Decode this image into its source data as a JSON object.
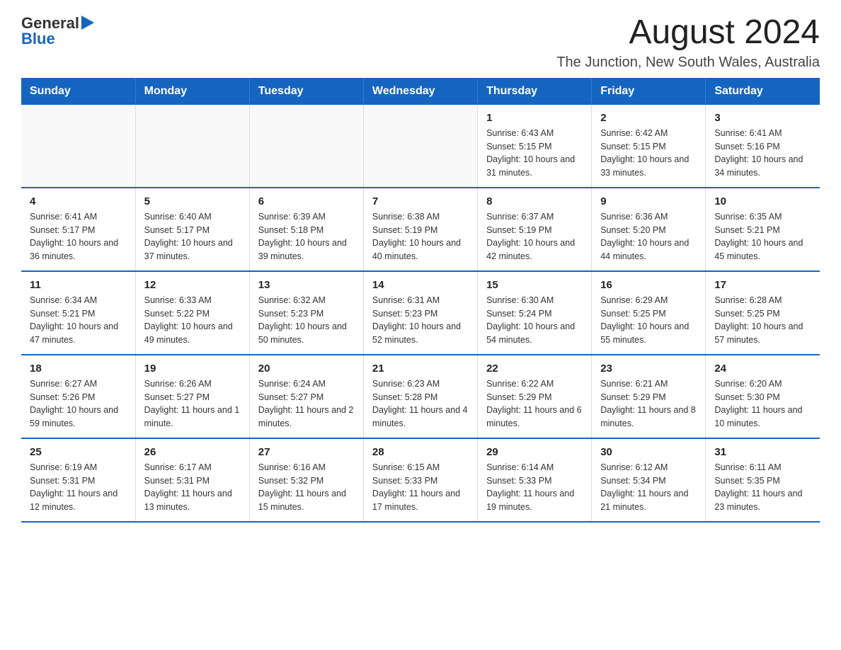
{
  "header": {
    "logo": {
      "general": "General",
      "arrow": "▶",
      "blue": "Blue"
    },
    "month_title": "August 2024",
    "location": "The Junction, New South Wales, Australia"
  },
  "weekdays": [
    "Sunday",
    "Monday",
    "Tuesday",
    "Wednesday",
    "Thursday",
    "Friday",
    "Saturday"
  ],
  "weeks": [
    [
      {
        "day": "",
        "info": ""
      },
      {
        "day": "",
        "info": ""
      },
      {
        "day": "",
        "info": ""
      },
      {
        "day": "",
        "info": ""
      },
      {
        "day": "1",
        "info": "Sunrise: 6:43 AM\nSunset: 5:15 PM\nDaylight: 10 hours and 31 minutes."
      },
      {
        "day": "2",
        "info": "Sunrise: 6:42 AM\nSunset: 5:15 PM\nDaylight: 10 hours and 33 minutes."
      },
      {
        "day": "3",
        "info": "Sunrise: 6:41 AM\nSunset: 5:16 PM\nDaylight: 10 hours and 34 minutes."
      }
    ],
    [
      {
        "day": "4",
        "info": "Sunrise: 6:41 AM\nSunset: 5:17 PM\nDaylight: 10 hours and 36 minutes."
      },
      {
        "day": "5",
        "info": "Sunrise: 6:40 AM\nSunset: 5:17 PM\nDaylight: 10 hours and 37 minutes."
      },
      {
        "day": "6",
        "info": "Sunrise: 6:39 AM\nSunset: 5:18 PM\nDaylight: 10 hours and 39 minutes."
      },
      {
        "day": "7",
        "info": "Sunrise: 6:38 AM\nSunset: 5:19 PM\nDaylight: 10 hours and 40 minutes."
      },
      {
        "day": "8",
        "info": "Sunrise: 6:37 AM\nSunset: 5:19 PM\nDaylight: 10 hours and 42 minutes."
      },
      {
        "day": "9",
        "info": "Sunrise: 6:36 AM\nSunset: 5:20 PM\nDaylight: 10 hours and 44 minutes."
      },
      {
        "day": "10",
        "info": "Sunrise: 6:35 AM\nSunset: 5:21 PM\nDaylight: 10 hours and 45 minutes."
      }
    ],
    [
      {
        "day": "11",
        "info": "Sunrise: 6:34 AM\nSunset: 5:21 PM\nDaylight: 10 hours and 47 minutes."
      },
      {
        "day": "12",
        "info": "Sunrise: 6:33 AM\nSunset: 5:22 PM\nDaylight: 10 hours and 49 minutes."
      },
      {
        "day": "13",
        "info": "Sunrise: 6:32 AM\nSunset: 5:23 PM\nDaylight: 10 hours and 50 minutes."
      },
      {
        "day": "14",
        "info": "Sunrise: 6:31 AM\nSunset: 5:23 PM\nDaylight: 10 hours and 52 minutes."
      },
      {
        "day": "15",
        "info": "Sunrise: 6:30 AM\nSunset: 5:24 PM\nDaylight: 10 hours and 54 minutes."
      },
      {
        "day": "16",
        "info": "Sunrise: 6:29 AM\nSunset: 5:25 PM\nDaylight: 10 hours and 55 minutes."
      },
      {
        "day": "17",
        "info": "Sunrise: 6:28 AM\nSunset: 5:25 PM\nDaylight: 10 hours and 57 minutes."
      }
    ],
    [
      {
        "day": "18",
        "info": "Sunrise: 6:27 AM\nSunset: 5:26 PM\nDaylight: 10 hours and 59 minutes."
      },
      {
        "day": "19",
        "info": "Sunrise: 6:26 AM\nSunset: 5:27 PM\nDaylight: 11 hours and 1 minute."
      },
      {
        "day": "20",
        "info": "Sunrise: 6:24 AM\nSunset: 5:27 PM\nDaylight: 11 hours and 2 minutes."
      },
      {
        "day": "21",
        "info": "Sunrise: 6:23 AM\nSunset: 5:28 PM\nDaylight: 11 hours and 4 minutes."
      },
      {
        "day": "22",
        "info": "Sunrise: 6:22 AM\nSunset: 5:29 PM\nDaylight: 11 hours and 6 minutes."
      },
      {
        "day": "23",
        "info": "Sunrise: 6:21 AM\nSunset: 5:29 PM\nDaylight: 11 hours and 8 minutes."
      },
      {
        "day": "24",
        "info": "Sunrise: 6:20 AM\nSunset: 5:30 PM\nDaylight: 11 hours and 10 minutes."
      }
    ],
    [
      {
        "day": "25",
        "info": "Sunrise: 6:19 AM\nSunset: 5:31 PM\nDaylight: 11 hours and 12 minutes."
      },
      {
        "day": "26",
        "info": "Sunrise: 6:17 AM\nSunset: 5:31 PM\nDaylight: 11 hours and 13 minutes."
      },
      {
        "day": "27",
        "info": "Sunrise: 6:16 AM\nSunset: 5:32 PM\nDaylight: 11 hours and 15 minutes."
      },
      {
        "day": "28",
        "info": "Sunrise: 6:15 AM\nSunset: 5:33 PM\nDaylight: 11 hours and 17 minutes."
      },
      {
        "day": "29",
        "info": "Sunrise: 6:14 AM\nSunset: 5:33 PM\nDaylight: 11 hours and 19 minutes."
      },
      {
        "day": "30",
        "info": "Sunrise: 6:12 AM\nSunset: 5:34 PM\nDaylight: 11 hours and 21 minutes."
      },
      {
        "day": "31",
        "info": "Sunrise: 6:11 AM\nSunset: 5:35 PM\nDaylight: 11 hours and 23 minutes."
      }
    ]
  ]
}
